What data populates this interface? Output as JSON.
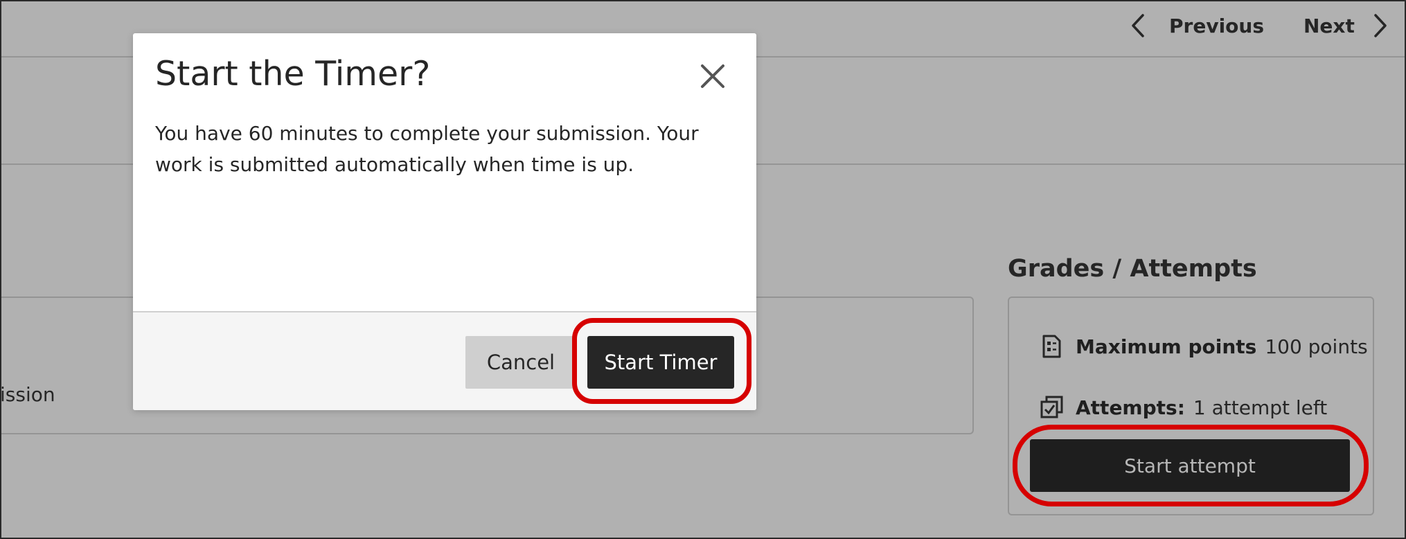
{
  "nav": {
    "previous_label": "Previous",
    "next_label": "Next",
    "previous_icon": "chevron-left-icon",
    "next_icon": "chevron-right-icon"
  },
  "background": {
    "content_fragment": "ission"
  },
  "grades": {
    "heading": "Grades / Attempts",
    "max_points_label": "Maximum points",
    "max_points_value": "100 points",
    "max_points_icon": "grade-sheet-icon",
    "attempts_label": "Attempts:",
    "attempts_value": "1 attempt left",
    "attempts_icon": "attempts-checkbox-icon",
    "start_attempt_label": "Start attempt"
  },
  "modal": {
    "title": "Start the Timer?",
    "body": "You have 60 minutes to complete your submission. Your work is submitted automatically when time is up.",
    "close_icon": "close-icon",
    "cancel_label": "Cancel",
    "start_timer_label": "Start Timer"
  },
  "colors": {
    "overlay_gray": "#b1b1b1",
    "highlight_red": "#d60000",
    "primary_button": "#262626",
    "dark_button": "#1e1e1e"
  }
}
